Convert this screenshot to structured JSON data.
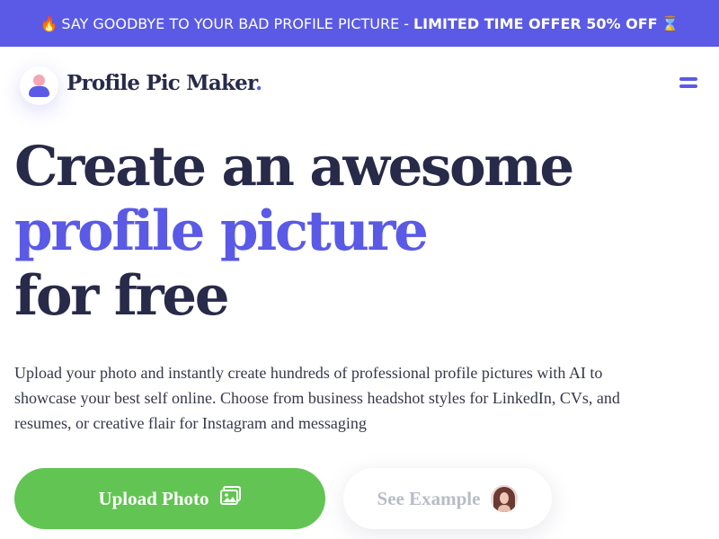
{
  "promo": {
    "fire_icon": "🔥",
    "text": "SAY GOODBYE TO YOUR BAD PROFILE PICTURE",
    "separator": "-",
    "offer": "LIMITED TIME OFFER 50% OFF",
    "hourglass_icon": "⌛"
  },
  "header": {
    "logo_text": "Profile Pic Maker",
    "logo_dot": ".",
    "logo_icon": "user-icon",
    "menu_icon": "hamburger-menu-icon"
  },
  "hero": {
    "line1": "Create an awesome",
    "line2": "profile picture",
    "line3": "for free",
    "description": "Upload your photo and instantly create hundreds of professional profile pictures with AI to showcase your best self online. Choose from business headshot styles for LinkedIn, CVs, and resumes, or creative flair for Instagram and messaging"
  },
  "cta": {
    "upload_label": "Upload Photo",
    "upload_icon": "image-upload-icon",
    "example_label": "See Example",
    "example_icon": "avatar-photo"
  },
  "colors": {
    "accent": "#5a5ae6",
    "dark_text": "#272a48",
    "upload_green": "#62c553",
    "muted_text": "#b9bcc6"
  }
}
